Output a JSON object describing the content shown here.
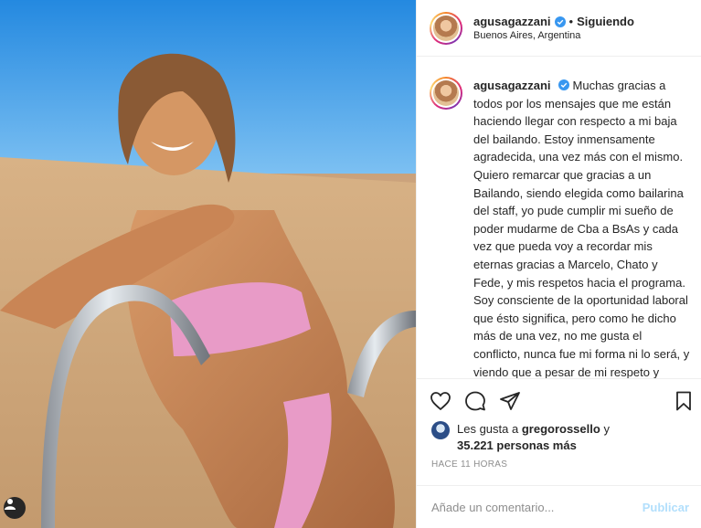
{
  "post": {
    "username": "agusagazzani",
    "follow_label": "Siguiendo",
    "separator": "•",
    "location": "Buenos Aires, Argentina"
  },
  "caption": {
    "username": "agusagazzani",
    "text": "Muchas gracias a todos por los mensajes que me están haciendo llegar con respecto a mi baja del bailando. Estoy inmensamente agradecida, una vez más con el mismo. Quiero remarcar que gracias a un Bailando, siendo elegida como bailarina del staff, yo pude cumplir mi sueño de poder mudarme de Cba a BsAs y cada vez que pueda voy a recordar mis eternas gracias a Marcelo, Chato y Fede, y mis respetos hacia el programa.",
    "text2": "Soy consciente de la oportunidad laboral que ésto significa, pero como he dicho más de una vez, no me gusta el conflicto, nunca fue mi forma ni lo será, y viendo que a pesar de mi respeto y ubicación con lo que refiere"
  },
  "actions": {
    "like_icon": "heart-icon",
    "comment_icon": "comment-icon",
    "share_icon": "send-icon",
    "save_icon": "bookmark-icon"
  },
  "likes": {
    "prefix": "Les gusta a",
    "user": "gregorossello",
    "joiner": "y",
    "count": "35.221 personas más"
  },
  "timestamp": "HACE 11 HORAS",
  "comment": {
    "placeholder": "Añade un comentario...",
    "publish_label": "Publicar"
  },
  "colors": {
    "verified": "#3897f0",
    "publish_disabled": "#b2dffc",
    "muted": "#8e8e8e"
  }
}
